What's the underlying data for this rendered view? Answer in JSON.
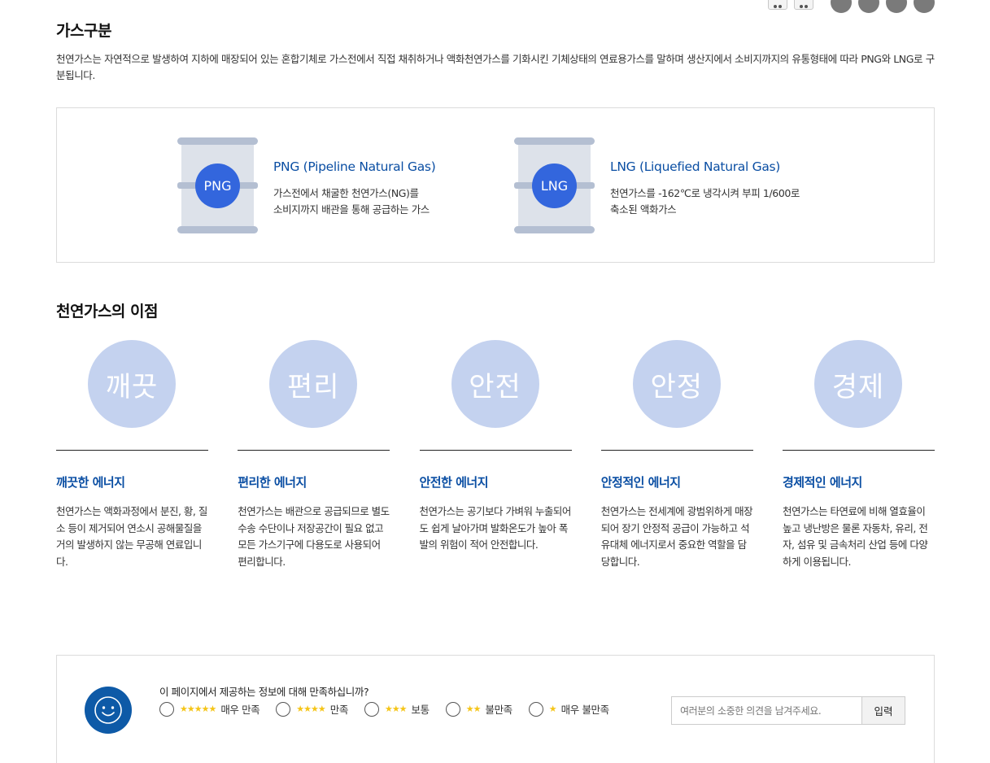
{
  "top_icons": {
    "icons": [
      "print-icon",
      "share-icon"
    ],
    "circles": 4
  },
  "gas_section": {
    "title": "가스구분",
    "intro": "천연가스는 자연적으로 발생하여 지하에 매장되어 있는 혼합기체로 가스전에서 직접 채취하거나 액화천연가스를 기화시킨 기체상태의 연료용가스를 말하며 생산지에서 소비지까지의 유통형태에 따라 PNG와 LNG로 구분됩니다.",
    "items": [
      {
        "badge": "PNG",
        "name": "PNG (Pipeline Natural Gas)",
        "desc_line1": "가스전에서 채굴한 천연가스(NG)를",
        "desc_line2": "소비지까지 배관을 통해 공급하는 가스"
      },
      {
        "badge": "LNG",
        "name": "LNG (Liquefied Natural Gas)",
        "desc_line1": "천연가스를 -162℃로 냉각시켜 부피 1/600로",
        "desc_line2": "축소된 액화가스"
      }
    ]
  },
  "benefits_section": {
    "title": "천연가스의 이점",
    "items": [
      {
        "circle": "깨끗",
        "title": "깨끗한 에너지",
        "desc": "천연가스는 액화과정에서 분진, 황, 질소 등이 제거되어 연소시 공해물질을 거의 발생하지 않는 무공해 연료입니다."
      },
      {
        "circle": "편리",
        "title": "편리한 에너지",
        "desc": "천연가스는 배관으로 공급되므로 별도 수송 수단이나 저장공간이 필요 없고 모든 가스기구에 다용도로 사용되어 편리합니다."
      },
      {
        "circle": "안전",
        "title": "안전한 에너지",
        "desc": "천연가스는 공기보다 가벼워 누출되어도 쉽게 날아가며 발화온도가 높아 폭발의 위험이 적어 안전합니다."
      },
      {
        "circle": "안정",
        "title": "안정적인 에너지",
        "desc": "천연가스는 전세계에 광범위하게 매장되어 장기 안정적 공급이 가능하고 석유대체 에너지로서 중요한 역할을 담당합니다."
      },
      {
        "circle": "경제",
        "title": "경제적인 에너지",
        "desc": "천연가스는 타연료에 비해 열효율이 높고 냉난방은 물론 자동차, 유리, 전자, 섬유 및 금속처리 산업 등에 다양하게 이용됩니다."
      }
    ]
  },
  "survey": {
    "question": "이 페이지에서 제공하는 정보에 대해 만족하십니까?",
    "options": [
      {
        "stars": "★★★★★",
        "label": "매우 만족"
      },
      {
        "stars": "★★★★",
        "label": "만족"
      },
      {
        "stars": "★★★",
        "label": "보통"
      },
      {
        "stars": "★★",
        "label": "불만족"
      },
      {
        "stars": "★",
        "label": "매우 불만족"
      }
    ],
    "opinion_placeholder": "여러분의 소중한 의견을 남겨주세요.",
    "submit_label": "입력"
  },
  "colors": {
    "accent_blue": "#0a4ea3",
    "badge_blue": "#3366dd",
    "benefit_circle": "#c4d2ef",
    "tank_body": "#dde2ea",
    "tank_cap": "#b4bfd2",
    "star": "#f5c518",
    "smiley_bg": "#0e5aa7"
  }
}
